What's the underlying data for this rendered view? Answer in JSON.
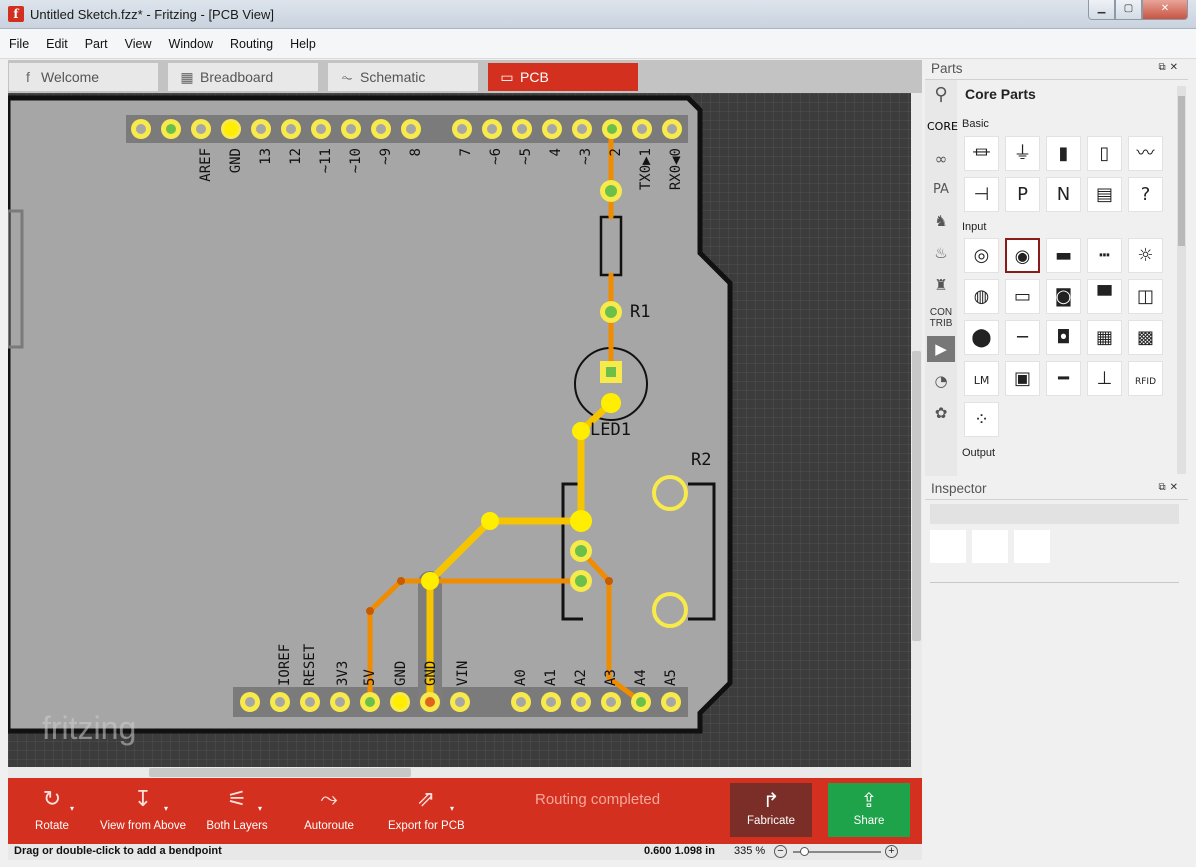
{
  "window": {
    "title": "Untitled Sketch.fzz* - Fritzing - [PCB View]",
    "app_icon": "f",
    "minimize_glyph": "▁",
    "maximize_glyph": "▢",
    "close_glyph": "✕"
  },
  "menu": [
    "File",
    "Edit",
    "Part",
    "View",
    "Window",
    "Routing",
    "Help"
  ],
  "tabs": [
    {
      "label": "Welcome",
      "icon": "fritzing-icon",
      "glyph": "f"
    },
    {
      "label": "Breadboard",
      "icon": "breadboard-icon",
      "glyph": "▦"
    },
    {
      "label": "Schematic",
      "icon": "schematic-icon",
      "glyph": "⏦"
    },
    {
      "label": "PCB",
      "icon": "pcb-icon",
      "glyph": "▭"
    }
  ],
  "pcb": {
    "top_header_labels": [
      "AREF",
      "GND",
      "13",
      "12",
      "~11",
      "~10",
      "~9",
      "8",
      "7",
      "~6",
      "~5",
      "4",
      "~3",
      "2",
      "TX0▶1",
      "RX0◀0"
    ],
    "bottom_header_labels": [
      "IOREF",
      "RESET",
      "3V3",
      "5V",
      "GND",
      "GND",
      "VIN",
      "A0",
      "A1",
      "A2",
      "A3",
      "A4",
      "A5"
    ],
    "part_labels": {
      "r1": "R1",
      "led1": "LED1",
      "r2": "R2"
    },
    "watermark": "fritzing",
    "colors": {
      "board": "#a6a6a6",
      "trace_top": "#f7c500",
      "trace_bottom": "#f08c00",
      "pad": "#f7ea4a",
      "pad_green": "#6cc04a"
    }
  },
  "toolbar": {
    "rotate": "Rotate",
    "view_from_above": "View from Above",
    "both_layers": "Both Layers",
    "autoroute": "Autoroute",
    "export": "Export for PCB",
    "routing_status": "Routing completed",
    "fabricate": "Fabricate",
    "share": "Share",
    "icons": {
      "rotate": "↻",
      "view": "↧",
      "layers": "⚟",
      "autoroute": "⤳",
      "export": "⇗",
      "fabricate": "↱",
      "share": "⇪",
      "dropdown": "▾"
    }
  },
  "status": {
    "hint": "Drag or double-click to add a bendpoint",
    "coords": "0.600 1.098 in",
    "zoom": "335 %",
    "zoom_minus": "−",
    "zoom_plus": "+"
  },
  "parts_panel": {
    "title": "Parts",
    "bin_title": "Core Parts",
    "bins": [
      "CORE",
      "CON TRIB"
    ],
    "sections": [
      "Basic",
      "Input",
      "Output"
    ],
    "search_glyph": "⚲",
    "menu_glyph": "≡",
    "panel_ctrl": "⧉✕",
    "bin_icons": [
      "arduino-icon",
      "pa-icon",
      "seeed-icon",
      "sparkfun-icon",
      "snootlab-icon",
      "contrib-icon",
      "play-icon",
      "lilypad-icon",
      "flower-icon"
    ],
    "bin_glyphs": [
      "∞",
      "PA",
      "♞",
      "♨",
      "♜",
      "▶",
      "◔",
      "✿"
    ],
    "basic_parts": [
      {
        "name": "resistor",
        "glyph": "⏛"
      },
      {
        "name": "ceramic-capacitor",
        "glyph": "⏚"
      },
      {
        "name": "electrolytic-capacitor",
        "glyph": "▮"
      },
      {
        "name": "battery",
        "glyph": "▯"
      },
      {
        "name": "inductor",
        "glyph": "〰"
      },
      {
        "name": "diode",
        "glyph": "⊣"
      },
      {
        "name": "pnp-transistor",
        "glyph": "P"
      },
      {
        "name": "npn-transistor",
        "glyph": "N"
      },
      {
        "name": "ic",
        "glyph": "▤"
      },
      {
        "name": "mystery-part",
        "glyph": "?"
      }
    ],
    "input_parts": [
      {
        "name": "potentiometer",
        "glyph": "◎"
      },
      {
        "name": "rotary-potentiometer",
        "glyph": "◉"
      },
      {
        "name": "toggle-switch",
        "glyph": "▬"
      },
      {
        "name": "pin-header",
        "glyph": "┅"
      },
      {
        "name": "ldr",
        "glyph": "☼"
      },
      {
        "name": "dial",
        "glyph": "◍"
      },
      {
        "name": "tilt-switch",
        "glyph": "▭"
      },
      {
        "name": "pushbutton",
        "glyph": "◙"
      },
      {
        "name": "slide-switch",
        "glyph": "▀"
      },
      {
        "name": "piezo",
        "glyph": "◫"
      },
      {
        "name": "fsr",
        "glyph": "⬤"
      },
      {
        "name": "flex-sensor",
        "glyph": "─"
      },
      {
        "name": "reed-switch",
        "glyph": "◘"
      },
      {
        "name": "distance-sensor",
        "glyph": "▦"
      },
      {
        "name": "accelerometer",
        "glyph": "▩"
      },
      {
        "name": "temperature-sensor",
        "glyph": "LM"
      },
      {
        "name": "gps-module",
        "glyph": "▣"
      },
      {
        "name": "capacitive-sensor",
        "glyph": "━"
      },
      {
        "name": "joystick",
        "glyph": "⊥"
      },
      {
        "name": "rfid-reader",
        "glyph": "RFID"
      },
      {
        "name": "humidity-sensor",
        "glyph": "⁘"
      }
    ]
  },
  "inspector_panel": {
    "title": "Inspector",
    "panel_ctrl": "⧉✕"
  }
}
